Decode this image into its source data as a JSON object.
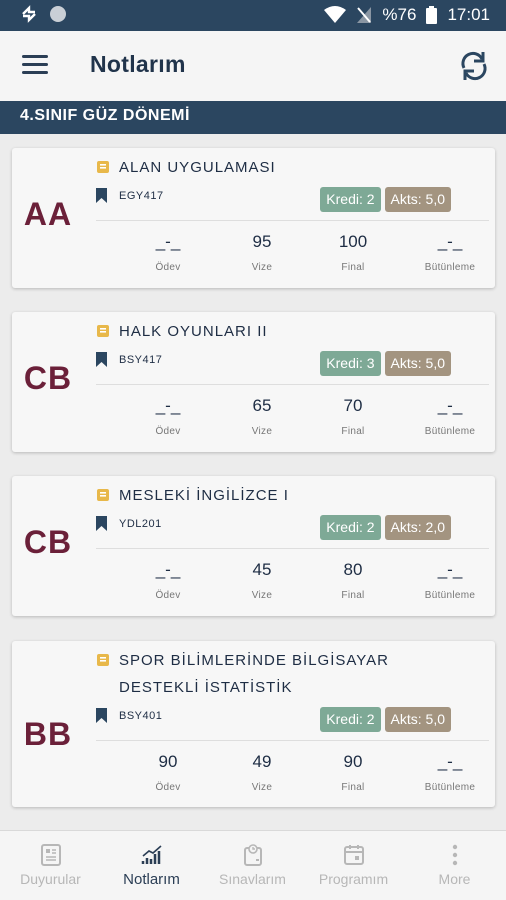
{
  "status_bar": {
    "battery": "%76",
    "time": "17:01"
  },
  "app_bar": {
    "title": "Notlarım"
  },
  "term": {
    "label": "4.SINIF GÜZ DÖNEMİ"
  },
  "score_labels": {
    "odev": "Ödev",
    "vize": "Vize",
    "final": "Final",
    "butunleme": "Bütünleme"
  },
  "courses": [
    {
      "grade": "AA",
      "name_lines": [
        "ALAN UYGULAMASI"
      ],
      "code": "EGY417",
      "kredi": "Kredi: 2",
      "akts": "Akts: 5,0",
      "odev": "_-_",
      "vize": "95",
      "final": "100",
      "butunleme": "_-_"
    },
    {
      "grade": "CB",
      "name_lines": [
        "HALK OYUNLARI II"
      ],
      "code": "BSY417",
      "kredi": "Kredi: 3",
      "akts": "Akts: 5,0",
      "odev": "_-_",
      "vize": "65",
      "final": "70",
      "butunleme": "_-_"
    },
    {
      "grade": "CB",
      "name_lines": [
        "MESLEKİ İNGİLİZCE I"
      ],
      "code": "YDL201",
      "kredi": "Kredi: 2",
      "akts": "Akts: 2,0",
      "odev": "_-_",
      "vize": "45",
      "final": "80",
      "butunleme": "_-_"
    },
    {
      "grade": "BB",
      "name_lines": [
        "SPOR BİLİMLERİNDE BİLGİSAYAR",
        "DESTEKLİ İSTATİSTİK"
      ],
      "code": "BSY401",
      "kredi": "Kredi: 2",
      "akts": "Akts: 5,0",
      "odev": "90",
      "vize": "49",
      "final": "90",
      "butunleme": "_-_"
    }
  ],
  "bottom_nav": [
    {
      "label": "Duyurular",
      "icon": "news-icon",
      "active": false
    },
    {
      "label": "Notlarım",
      "icon": "chart-icon",
      "active": true
    },
    {
      "label": "Sınavlarım",
      "icon": "exam-clipboard-icon",
      "active": false
    },
    {
      "label": "Programım",
      "icon": "calendar-icon",
      "active": false
    },
    {
      "label": "More",
      "icon": "more-vertical-icon",
      "active": false
    }
  ],
  "colors": {
    "primary": "#2b4660",
    "grade": "#6b2039",
    "kredi_badge": "#7ea996",
    "akts_badge": "#a39480",
    "book_icon": "#e8b84a"
  }
}
